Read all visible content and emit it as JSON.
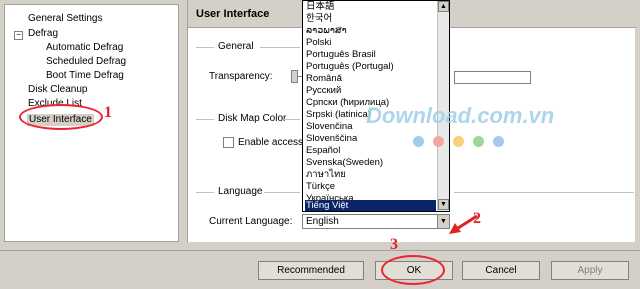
{
  "tree": {
    "items": [
      {
        "label": "General Settings"
      },
      {
        "label": "Defrag",
        "expander": "−"
      },
      {
        "label": "Automatic Defrag"
      },
      {
        "label": "Scheduled Defrag"
      },
      {
        "label": "Boot Time Defrag"
      },
      {
        "label": "Disk Cleanup"
      },
      {
        "label": "Exclude List"
      },
      {
        "label": "User Interface"
      }
    ]
  },
  "panel": {
    "title": "User Interface",
    "group_general": "General",
    "transparency_label": "Transparency:",
    "transparency_level_percent": 0,
    "group_diskmap": "Disk Map Color",
    "accessible_label": "Enable accessib",
    "group_language": "Language",
    "current_language_label": "Current Language:",
    "language_value": "English",
    "language_options": [
      "日本語",
      "한국어",
      "ລາວພາສາ",
      "Polski",
      "Português Brasil",
      "Português (Portugal)",
      "Română",
      "Русский",
      "Српски (ћирилица)",
      "Srpski (latinica)",
      "Slovenčina",
      "Slovenščina",
      "Español",
      "Svenska(Sweden)",
      "ภาษาไทย",
      "Türkçe",
      "Українська",
      "Tiếng Việt"
    ],
    "selected_option": "Tiếng Việt"
  },
  "buttons": {
    "recommended": "Recommended",
    "ok": "OK",
    "cancel": "Cancel",
    "apply": "Apply"
  },
  "annotations": {
    "step1": "1",
    "step2": "2",
    "step3": "3",
    "color": "#dd2222"
  },
  "watermark": {
    "text": "Download.com.vn",
    "colors": [
      "#9fd0e8",
      "#f4a6a6",
      "#f7d27a",
      "#9ed69a",
      "#a8c8f0"
    ]
  },
  "icons": {
    "scroll_up": "triangle-up-icon",
    "scroll_down": "triangle-down-icon",
    "combo_arrow": "triangle-down-icon",
    "arrow2": "red-arrow-icon"
  }
}
